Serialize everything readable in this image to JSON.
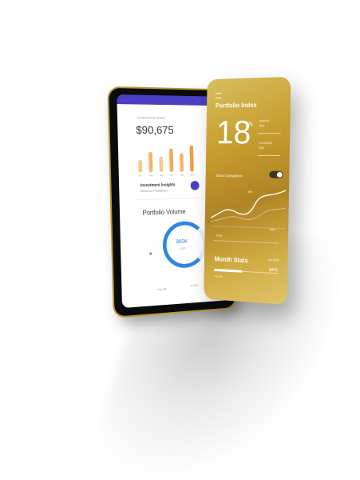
{
  "phone": {
    "header_label": "Investment Stats",
    "balance": "$90,675",
    "bar_labels": [
      "Jul",
      "Aug",
      "Sep",
      "Oct",
      "Nov",
      "Dec"
    ],
    "insights_title": "Investment Insights",
    "insights_sub": "Reference Predictions 1",
    "volume_title": "Portfolio Volume",
    "volume_value": "960K",
    "volume_unit": "USD",
    "volume_progress": 0.75,
    "foot_left": "Avg 8%",
    "foot_right": "% 19%"
  },
  "gold_card": {
    "title": "Portfolio Index",
    "big_number": "18",
    "percent": "%",
    "stock1_name": "APPLE",
    "stock1_value": "$12",
    "stock2_name": "GOOGLE",
    "stock2_value": "$30",
    "compare_label": "Show Comparison",
    "chart_label": "4%",
    "year_start": "2018",
    "year_end": "2017",
    "month_title": "Month Stats",
    "month_right": "Jan 2018",
    "bottom_left": "+8.1%",
    "bottom_right": "$406"
  },
  "colors": {
    "accent": "#4a3fc4",
    "ring": "#2e86e0",
    "gold": "#c79e2e"
  }
}
